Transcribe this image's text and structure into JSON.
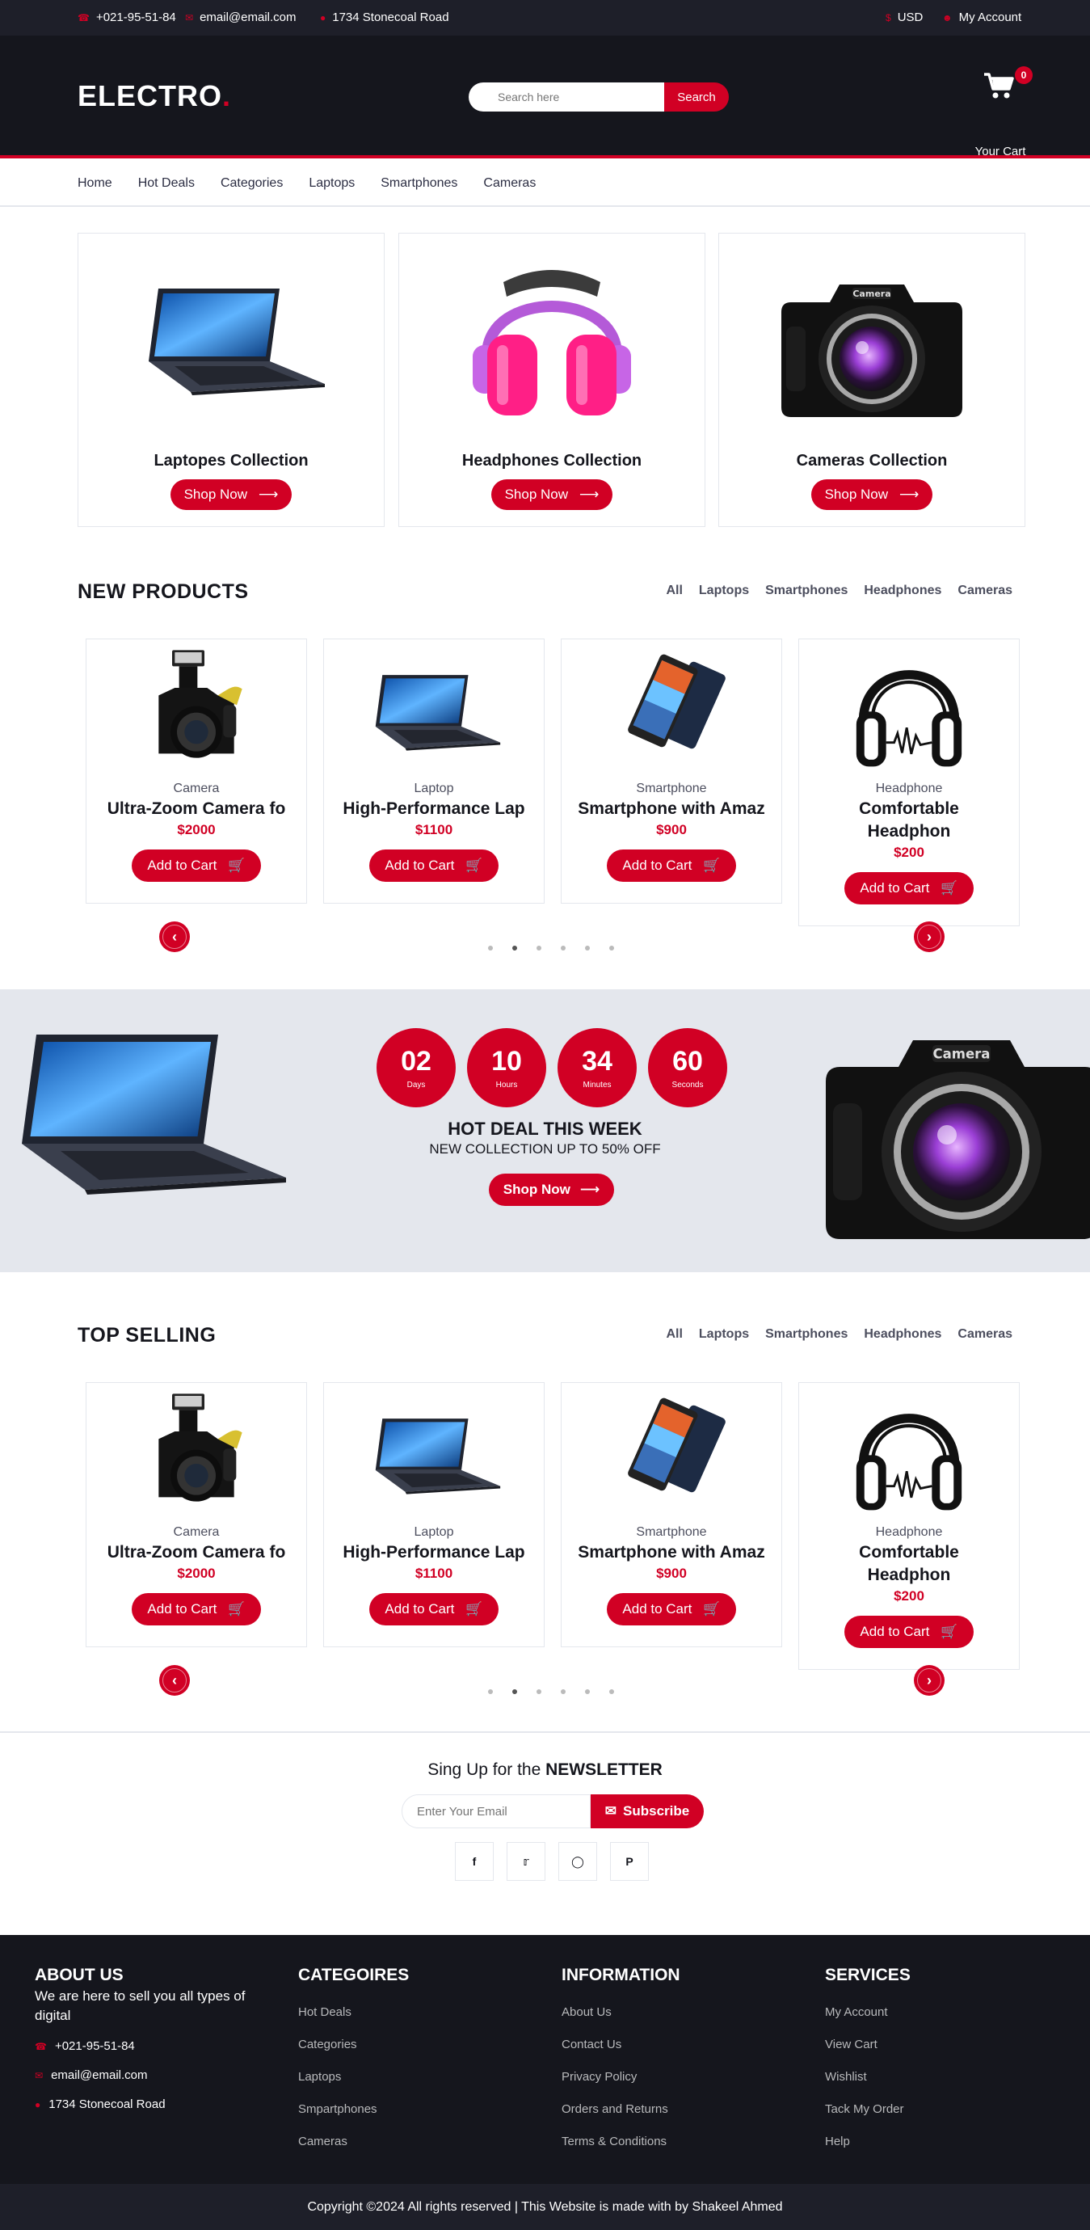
{
  "topbar": {
    "phone": "+021-95-51-84",
    "email": "email@email.com",
    "address": "1734 Stonecoal Road",
    "currency": "USD",
    "account": "My Account"
  },
  "header": {
    "logo": "ELECTRO",
    "logo_dot": ".",
    "search_placeholder": "Search here",
    "search_button": "Search",
    "cart_count": "0",
    "cart_label": "Your Cart"
  },
  "nav": [
    "Home",
    "Hot Deals",
    "Categories",
    "Laptops",
    "Smartphones",
    "Cameras"
  ],
  "collections": [
    {
      "title": "Laptopes Collection",
      "button": "Shop Now",
      "icon": "laptop"
    },
    {
      "title": "Headphones Collection",
      "button": "Shop Now",
      "icon": "headphones"
    },
    {
      "title": "Cameras Collection",
      "button": "Shop Now",
      "icon": "camera"
    }
  ],
  "new_products": {
    "title": "NEW PRODUCTS",
    "tabs": [
      "All",
      "Laptops",
      "Smartphones",
      "Headphones",
      "Cameras"
    ],
    "products": [
      {
        "category": "Camera",
        "name": "Ultra-Zoom Camera fo",
        "price": "$2000",
        "button": "Add to Cart",
        "icon": "camera"
      },
      {
        "category": "Laptop",
        "name": "High-Performance Lap",
        "price": "$1100",
        "button": "Add to Cart",
        "icon": "laptop"
      },
      {
        "category": "Smartphone",
        "name": "Smartphone with Amaz",
        "price": "$900",
        "button": "Add to Cart",
        "icon": "smartphone"
      },
      {
        "category": "Headphone",
        "name": "Comfortable Headphon",
        "price": "$200",
        "button": "Add to Cart",
        "icon": "headphones"
      }
    ]
  },
  "hot_deal": {
    "countdown": [
      {
        "value": "02",
        "unit": "Days"
      },
      {
        "value": "10",
        "unit": "Hours"
      },
      {
        "value": "34",
        "unit": "Minutes"
      },
      {
        "value": "60",
        "unit": "Seconds"
      }
    ],
    "title": "HOT DEAL THIS WEEK",
    "subtitle": "NEW COLLECTION UP TO 50% OFF",
    "button": "Shop Now"
  },
  "top_selling": {
    "title": "TOP SELLING",
    "tabs": [
      "All",
      "Laptops",
      "Smartphones",
      "Headphones",
      "Cameras"
    ],
    "products": [
      {
        "category": "Camera",
        "name": "Ultra-Zoom Camera fo",
        "price": "$2000",
        "button": "Add to Cart",
        "icon": "camera"
      },
      {
        "category": "Laptop",
        "name": "High-Performance Lap",
        "price": "$1100",
        "button": "Add to Cart",
        "icon": "laptop"
      },
      {
        "category": "Smartphone",
        "name": "Smartphone with Amaz",
        "price": "$900",
        "button": "Add to Cart",
        "icon": "smartphone"
      },
      {
        "category": "Headphone",
        "name": "Comfortable Headphon",
        "price": "$200",
        "button": "Add to Cart",
        "icon": "headphones"
      }
    ]
  },
  "newsletter": {
    "title_prefix": "Sing Up for the ",
    "title_bold": "NEWSLETTER",
    "placeholder": "Enter Your Email",
    "button": "Subscribe",
    "social": [
      "facebook-icon",
      "twitter-icon",
      "instagram-icon",
      "pinterest-icon"
    ]
  },
  "footer": {
    "about": {
      "title": "ABOUT US",
      "text": "We are here to sell you all types of digital",
      "phone": "+021-95-51-84",
      "email": "email@email.com",
      "address": "1734 Stonecoal Road"
    },
    "categories": {
      "title": "CATEGOIRES",
      "links": [
        "Hot Deals",
        "Categories",
        "Laptops",
        "Smpartphones",
        "Cameras"
      ]
    },
    "information": {
      "title": "INFORMATION",
      "links": [
        "About Us",
        "Contact Us",
        "Privacy Policy",
        "Orders and Returns",
        "Terms & Conditions"
      ]
    },
    "services": {
      "title": "SERVICES",
      "links": [
        "My Account",
        "View Cart",
        "Wishlist",
        "Tack My Order",
        "Help"
      ]
    },
    "copyright": "Copyright ©2024 All rights reserved | This Website is made with by Shakeel Ahmed"
  },
  "colors": {
    "accent": "#d10024",
    "dark": "#15161d",
    "topbar": "#1e1f29",
    "light": "#e4e7ed"
  }
}
